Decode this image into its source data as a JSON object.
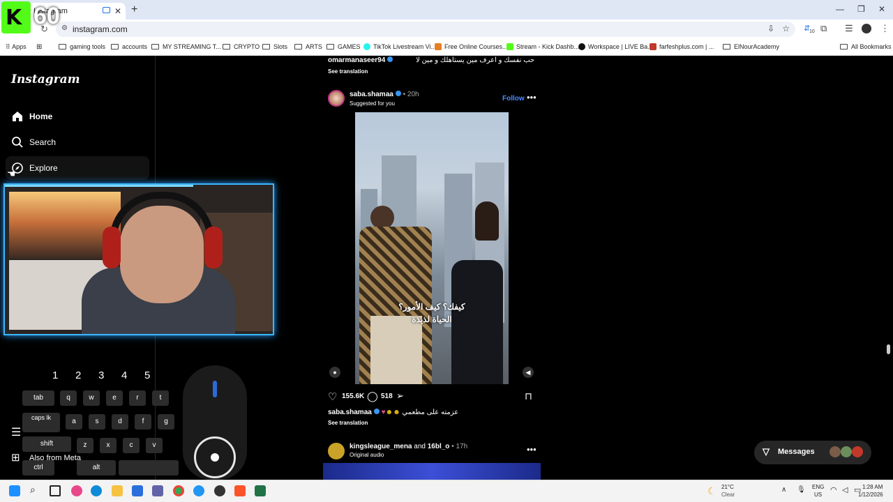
{
  "overlay": {
    "badge_text": "60"
  },
  "browser": {
    "tab_title": "Instagram",
    "url": "instagram.com",
    "bookmarks": [
      "Apps",
      "gaming tools",
      "accounts",
      "MY STREAMING T...",
      "CRYPTO",
      "Slots",
      "ARTS",
      "GAMES",
      "TikTok Livestream Vi...",
      "Free Online Courses...",
      "Stream - Kick Dashb...",
      "Workspace | LIVE Ba...",
      "farfeshplus.com | ...",
      "ElNourAcademy",
      "All Bookmarks"
    ],
    "extension_badge": "10"
  },
  "sidebar": {
    "logo": "Instagram",
    "items": [
      {
        "label": "Home",
        "icon": "home-icon"
      },
      {
        "label": "Search",
        "icon": "search-icon"
      },
      {
        "label": "Explore",
        "icon": "compass-icon"
      }
    ],
    "partial_label": "Also from Meta"
  },
  "feed": {
    "prev_post": {
      "username": "omarmanaseer94",
      "caption": "حب نفسك و اعرف مين يستاهلك و مين لا",
      "see_translation": "See translation"
    },
    "post": {
      "username": "saba.shamaa",
      "time": "20h",
      "subtitle": "Suggested for you",
      "follow": "Follow",
      "overlay_line1": "كيفك؟ كيف الأمور؟",
      "overlay_line2": "الحياة لذيذة",
      "likes": "155.6K",
      "comments": "518",
      "caption_user": "saba.shamaa",
      "caption": "عزمته على مطعمي",
      "see_translation": "See translation"
    },
    "next_post": {
      "username": "kingsleague_mena",
      "and": "and",
      "coauthor": "16bl_o",
      "time": "17h",
      "subtitle": "Original audio"
    }
  },
  "messages": {
    "label": "Messages"
  },
  "keyboard": {
    "numbers": [
      "1",
      "2",
      "3",
      "4",
      "5"
    ],
    "row1": [
      "tab",
      "q",
      "w",
      "e",
      "r",
      "t"
    ],
    "row2": [
      "caps lk",
      "a",
      "s",
      "d",
      "f",
      "g"
    ],
    "row3": [
      "shift",
      "z",
      "x",
      "c",
      "v"
    ],
    "row4": [
      "ctrl",
      "alt"
    ]
  },
  "taskbar": {
    "temperature": "21°C",
    "weather": "Clear",
    "lang": "ENG",
    "region": "US",
    "time": "1:28 AM",
    "date": "1/12/2026"
  },
  "colors": {
    "accent": "#3897f0",
    "webcam_border": "#3bb6ff",
    "background": "#000000"
  }
}
